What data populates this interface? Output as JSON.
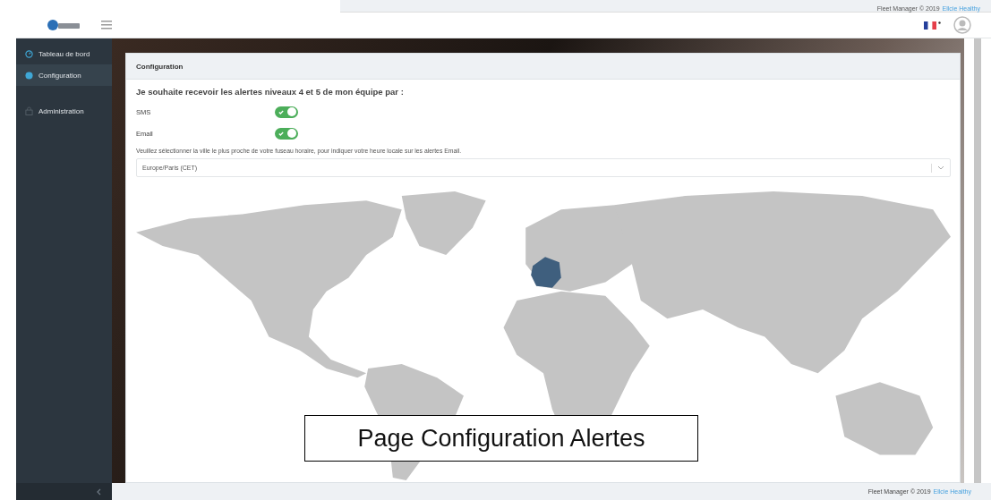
{
  "top_strip": {
    "text": "Fleet Manager © 2019",
    "link": "Ellcie Healthy"
  },
  "sidebar": {
    "items": [
      {
        "label": "Tableau de bord",
        "selected": false
      },
      {
        "label": "Configuration",
        "selected": true
      },
      {
        "label": "Administration",
        "selected": false
      }
    ]
  },
  "card": {
    "title": "Configuration",
    "heading": "Je souhaite recevoir les alertes niveaux 4 et 5 de mon équipe par :",
    "toggles": [
      {
        "label": "SMS",
        "on": true
      },
      {
        "label": "Email",
        "on": true
      }
    ],
    "timezone_hint": "Veuillez sélectionner la ville le plus proche de votre fuseau horaire, pour indiquer votre heure locale sur les alertes Email.",
    "timezone": "Europe/Paris (CET)"
  },
  "caption": "Page Configuration Alertes",
  "footer": {
    "text": "Fleet Manager © 2019",
    "link": "Ellcie Healthy"
  }
}
